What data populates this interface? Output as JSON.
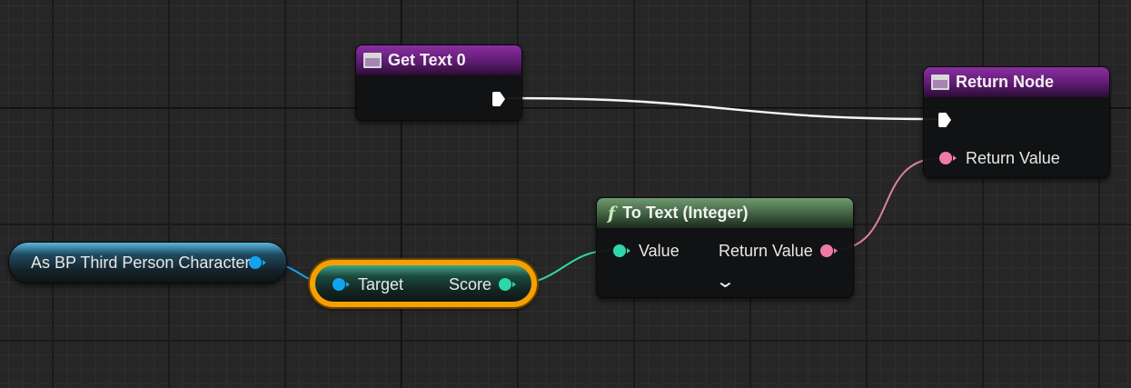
{
  "graph": {
    "get_text_node": {
      "title": "Get Text 0"
    },
    "return_node": {
      "title": "Return Node",
      "return_label": "Return Value"
    },
    "to_text_node": {
      "icon": "f",
      "title": "To Text (Integer)",
      "input_label": "Value",
      "output_label": "Return Value",
      "expand_glyph": "⌄"
    },
    "cast_node": {
      "label": "As BP Third Person Character"
    },
    "score_var_node": {
      "input_label": "Target",
      "output_label": "Score"
    }
  },
  "colors": {
    "object_pin": "#12a3f0",
    "integer_pin": "#2fd6a8",
    "text_pin": "#ef7aa5",
    "exec_pin": "#ffffff",
    "selection_outline": "#f5a000",
    "function_header": "#5e8a5e",
    "entry_header": "#7a2890"
  }
}
